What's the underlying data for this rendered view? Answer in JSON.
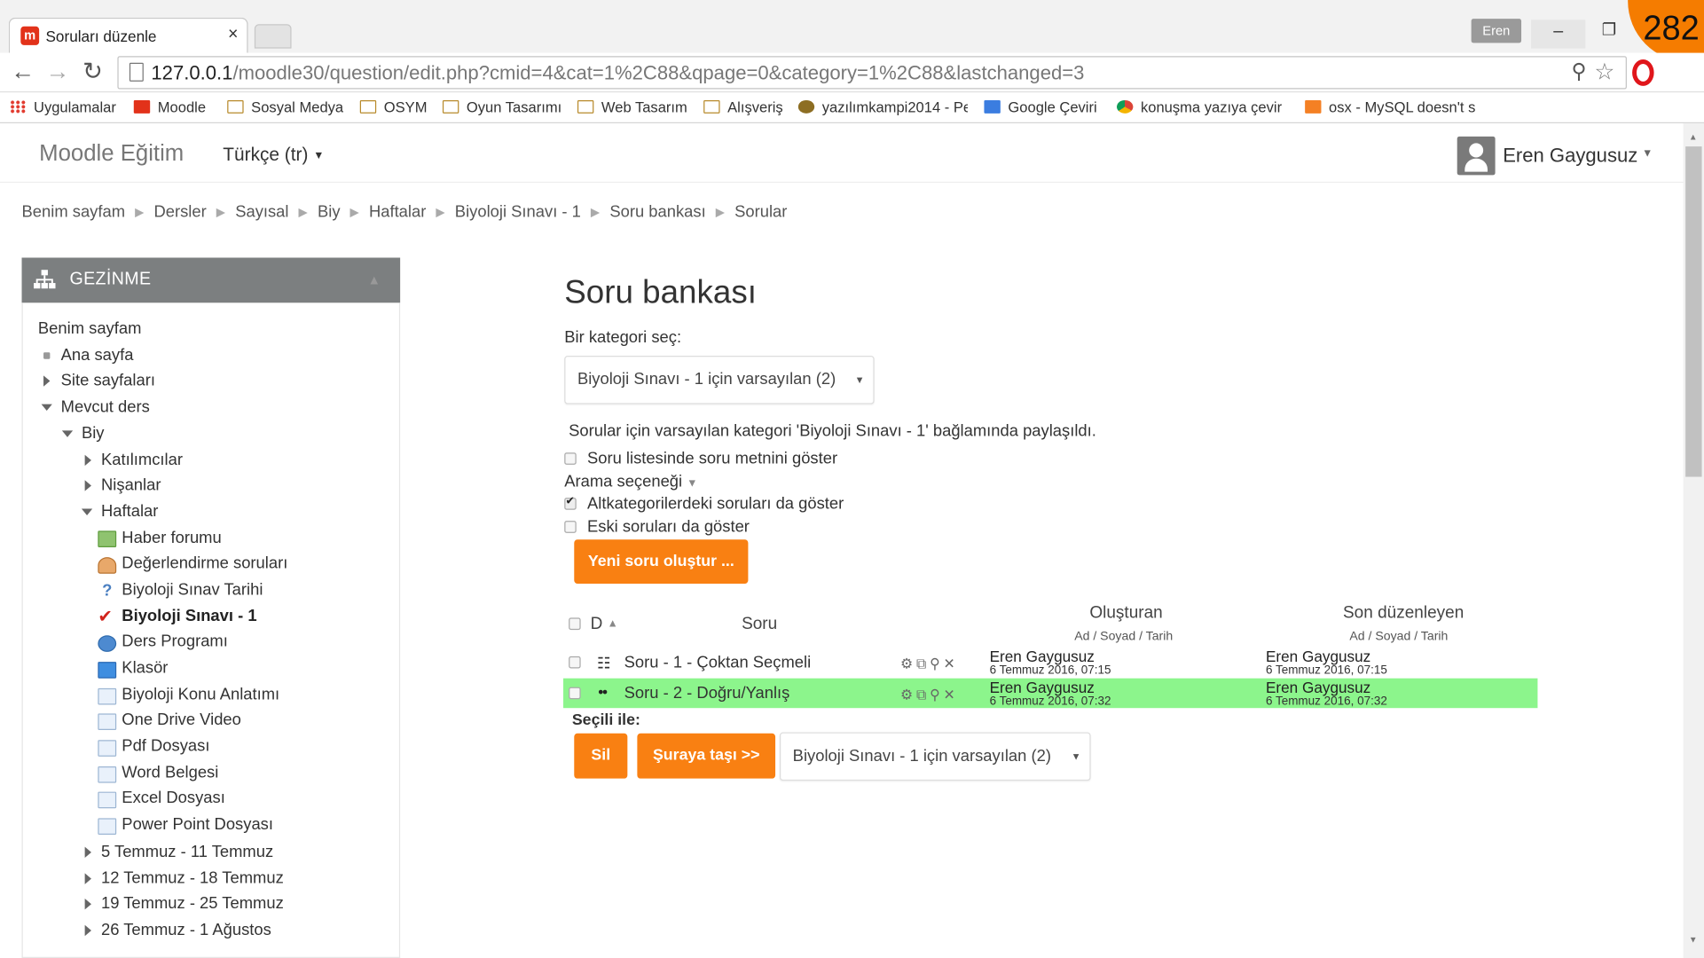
{
  "browser": {
    "tab_title": "Soruları düzenle",
    "tab_close": "×",
    "profile": "Eren",
    "minimize": "–",
    "restore": "❐",
    "url_host": "127.0.0.1",
    "url_path": "/moodle30/question/edit.php?cmid=4&cat=1%2C88&qpage=0&category=1%2C88&lastchanged=3",
    "bookmarks": [
      "Uygulamalar",
      "Moodle",
      "Sosyal Medya",
      "OSYM",
      "Oyun Tasarımı",
      "Web Tasarım",
      "Alışveriş",
      "yazılımkampi2014 - Pe",
      "Google Çeviri",
      "konuşma yazıya çevir",
      "osx - MySQL doesn't s"
    ]
  },
  "overlay_badge": "282",
  "site": {
    "brand": "Moodle Eğitim",
    "language": "Türkçe (tr)",
    "user": "Eren Gaygusuz"
  },
  "breadcrumb": [
    "Benim sayfam",
    "Dersler",
    "Sayısal",
    "Biy",
    "Haftalar",
    "Biyoloji Sınavı - 1",
    "Soru bankası",
    "Sorular"
  ],
  "breadcrumb_sep": "▶",
  "navigation": {
    "title": "GEZİNME",
    "items": [
      "Benim sayfam",
      "Ana sayfa",
      "Site sayfaları",
      "Mevcut ders",
      "Biy",
      "Katılımcılar",
      "Nişanlar",
      "Haftalar",
      "Haber forumu",
      "Değerlendirme soruları",
      "Biyoloji Sınav Tarihi",
      "Biyoloji Sınavı - 1",
      "Ders Programı",
      "Klasör",
      "Biyoloji Konu Anlatımı",
      "One Drive Video",
      "Pdf Dosyası",
      "Word Belgesi",
      "Excel Dosyası",
      "Power Point Dosyası",
      "5 Temmuz - 11 Temmuz",
      "12 Temmuz - 18 Temmuz",
      "19 Temmuz - 25 Temmuz",
      "26 Temmuz - 1 Ağustos"
    ]
  },
  "main": {
    "heading": "Soru bankası",
    "category_label": "Bir kategori seç:",
    "category_selected": "Biyoloji Sınavı - 1 için varsayılan (2)",
    "share_note": "Sorular için varsayılan kategori 'Biyoloji Sınavı - 1' bağlamında paylaşıldı.",
    "show_text": "Soru listesinde soru metnini göster",
    "search_options": "Arama seçeneği",
    "subcats": "Altkategorilerdeki soruları da göster",
    "old": "Eski soruları da göster",
    "new_question": "Yeni soru oluştur ...",
    "col_type": "D",
    "col_question": "Soru",
    "col_creator": "Oluşturan",
    "col_modifier": "Son düzenleyen",
    "name_sub": "Ad / Soyad / Tarih",
    "rows": [
      {
        "name": "Soru - 1 - Çoktan Seçmeli",
        "creator": "Eren Gaygusuz",
        "created": "6 Temmuz 2016, 07:15",
        "modifier": "Eren Gaygusuz",
        "modified": "6 Temmuz 2016, 07:15",
        "type_icon": "multichoice-icon"
      },
      {
        "name": "Soru - 2 - Doğru/Yanlış",
        "creator": "Eren Gaygusuz",
        "created": "6 Temmuz 2016, 07:32",
        "modifier": "Eren Gaygusuz",
        "modified": "6 Temmuz 2016, 07:32",
        "type_icon": "truefalse-icon"
      }
    ],
    "with_selected": "Seçili ile:",
    "delete": "Sil",
    "move": "Şuraya taşı >>",
    "move_target": "Biyoloji Sınavı - 1 için varsayılan (2)"
  },
  "colors": {
    "accent": "#f98012",
    "highlight_row": "#8cf58c",
    "block_header": "#7c7f80"
  }
}
